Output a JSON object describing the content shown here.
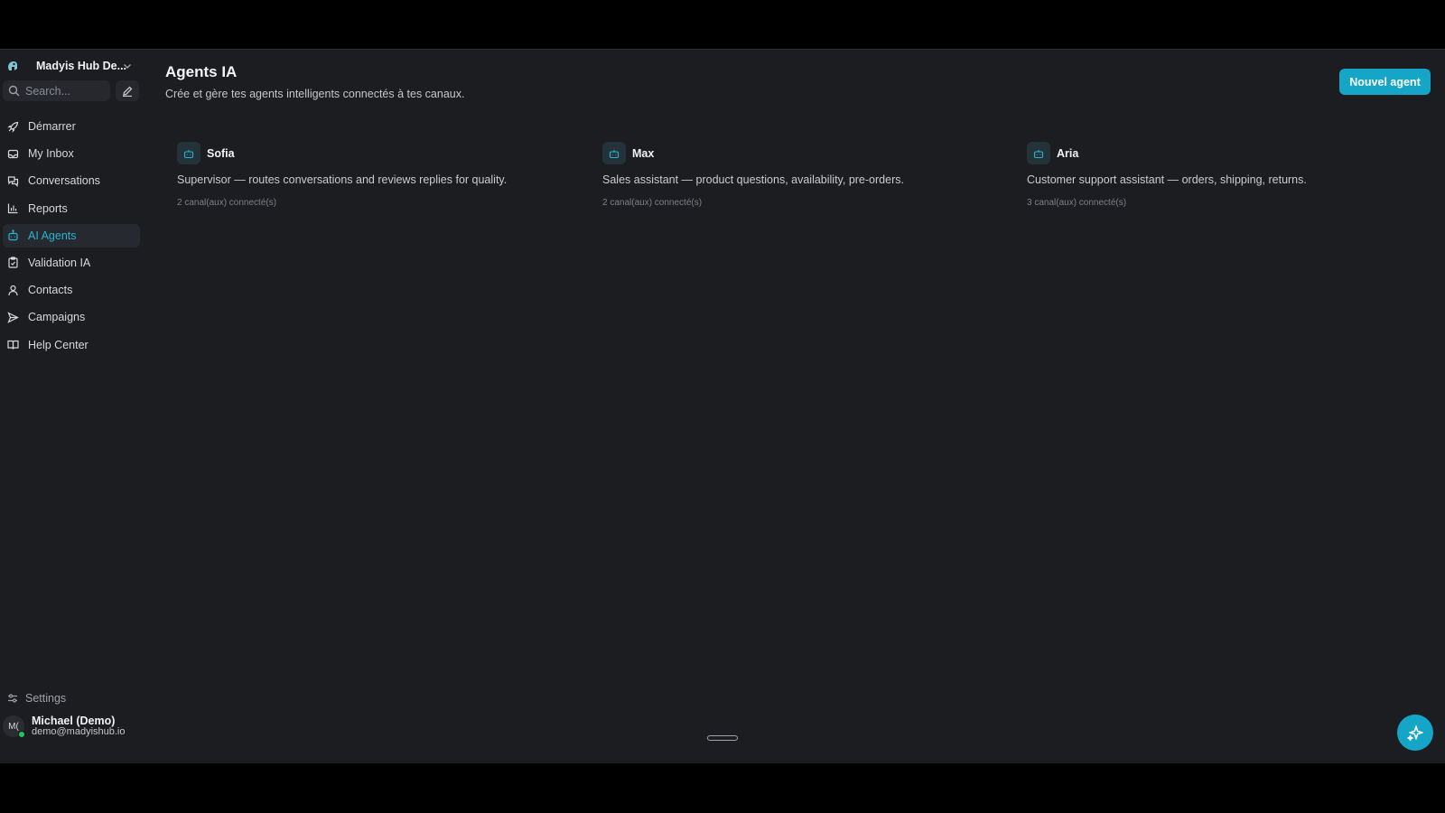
{
  "workspace": {
    "name": "Madyis Hub De..."
  },
  "search": {
    "placeholder": "Search..."
  },
  "nav": {
    "items": [
      {
        "label": "Démarrer",
        "icon": "rocket-icon"
      },
      {
        "label": "My Inbox",
        "icon": "inbox-icon"
      },
      {
        "label": "Conversations",
        "icon": "chat-icon"
      },
      {
        "label": "Reports",
        "icon": "bar-chart-icon"
      },
      {
        "label": "AI Agents",
        "icon": "bot-icon",
        "active": true
      },
      {
        "label": "Validation IA",
        "icon": "clipboard-check-icon"
      },
      {
        "label": "Contacts",
        "icon": "user-icon"
      },
      {
        "label": "Campaigns",
        "icon": "send-icon"
      },
      {
        "label": "Help Center",
        "icon": "book-icon"
      }
    ]
  },
  "settings": {
    "label": "Settings"
  },
  "user": {
    "initials": "M(",
    "name": "Michael (Demo)",
    "email": "demo@madyishub.io",
    "status": "online"
  },
  "page": {
    "title": "Agents IA",
    "subtitle": "Crée et gère tes agents intelligents connectés à tes canaux.",
    "new_button": "Nouvel agent"
  },
  "agents": [
    {
      "name": "Sofia",
      "description": "Supervisor — routes conversations and reviews replies for quality.",
      "channels": "2 canal(aux) connecté(s)"
    },
    {
      "name": "Max",
      "description": "Sales assistant — product questions, availability, pre-orders.",
      "channels": "2 canal(aux) connecté(s)"
    },
    {
      "name": "Aria",
      "description": "Customer support assistant — orders, shipping, returns.",
      "channels": "3 canal(aux) connecté(s)"
    }
  ],
  "colors": {
    "accent": "#15a5c6",
    "background": "#1c1d21",
    "active_nav_text": "#29b3cf",
    "status_online": "#22c55e"
  }
}
